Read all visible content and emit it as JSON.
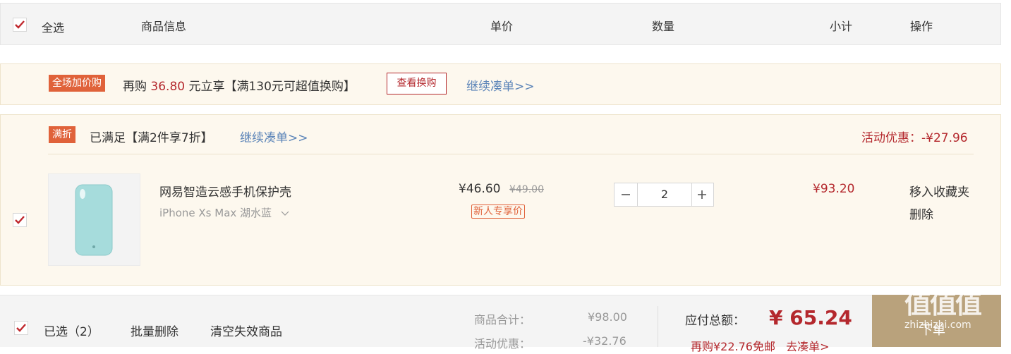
{
  "header": {
    "select_all": "全选",
    "col_info": "商品信息",
    "col_price": "单价",
    "col_qty": "数量",
    "col_subtotal": "小计",
    "col_action": "操作"
  },
  "promo": {
    "tag": "全场加价购",
    "text_prefix": "再购",
    "amount": "36.80",
    "text_suffix": "元立享【满130元可超值换购】",
    "view_button": "查看换购",
    "continue_link": "继续凑单>>"
  },
  "group": {
    "tag": "满折",
    "status_text": "已满足【满2件享7折】",
    "continue_link": "继续凑单>>",
    "discount_text": "活动优惠：-¥27.96"
  },
  "item": {
    "name": "网易智造云感手机保护壳",
    "spec": "iPhone Xs Max 湖水蓝",
    "price": "¥46.60",
    "original_price": "¥49.00",
    "badge": "新人专享价",
    "quantity": "2",
    "subtotal": "¥93.20",
    "move_to_favorites": "移入收藏夹",
    "delete": "删除",
    "product_color": "#a6dcdc"
  },
  "footer": {
    "selected_label": "已选（2）",
    "batch_delete": "批量删除",
    "clear_invalid": "清空失效商品",
    "goods_total_label": "商品合计：",
    "goods_total_value": "¥98.00",
    "discount_label": "活动优惠：",
    "discount_value": "-¥32.76",
    "pay_total_label": "应付总额：",
    "pay_total_value": "¥ 65.24",
    "shipping_hint": "再购¥22.76免邮",
    "shipping_link": "去凑单>",
    "checkout_button": "下单"
  },
  "watermark": {
    "logo_text": "值值值",
    "site": "zhizhizhi.com"
  },
  "colors": {
    "accent_red": "#b4282d",
    "tag_orange": "#e0623a",
    "link_blue": "#5b84b8",
    "checkout_gold": "#b9a27c"
  }
}
